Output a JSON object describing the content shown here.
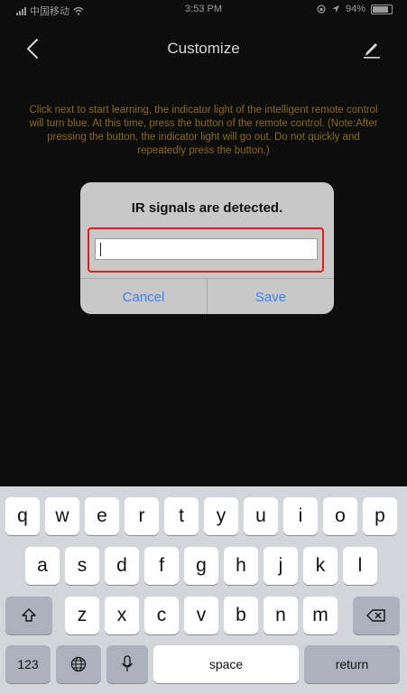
{
  "status_bar": {
    "carrier": "中国移动",
    "time": "3:53 PM",
    "battery": "94%"
  },
  "nav": {
    "title": "Customize"
  },
  "instructions": "Click next to start learning, the indicator light of the intelligent remote control will turn blue. At this time, press the button of the remote control. (Note:After pressing the button, the indicator light will go out. Do not quickly and repeatedly press the button.)",
  "dialog": {
    "title": "IR signals are detected.",
    "input_value": "",
    "cancel_label": "Cancel",
    "save_label": "Save"
  },
  "keyboard": {
    "row1": [
      "q",
      "w",
      "e",
      "r",
      "t",
      "y",
      "u",
      "i",
      "o",
      "p"
    ],
    "row2": [
      "a",
      "s",
      "d",
      "f",
      "g",
      "h",
      "j",
      "k",
      "l"
    ],
    "row3": [
      "z",
      "x",
      "c",
      "v",
      "b",
      "n",
      "m"
    ],
    "numbers_label": "123",
    "space_label": "space",
    "return_label": "return"
  },
  "colors": {
    "highlight": "#e01d1d",
    "action_blue": "#3b82f6",
    "instruction_text": "#8a6a1a"
  }
}
